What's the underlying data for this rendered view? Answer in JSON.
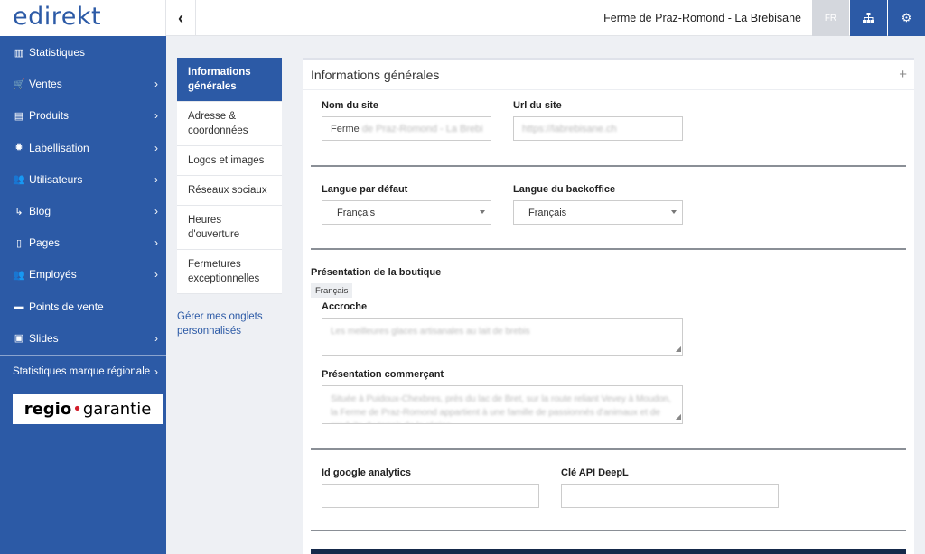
{
  "topbar": {
    "logo": "edirekt",
    "collapse_icon": "‹",
    "site_title": "Ferme de Praz-Romond - La Brebisane",
    "lang": "FR"
  },
  "sidebar": {
    "items": [
      {
        "icon": "chart-icon",
        "glyph": "▥",
        "label": "Statistiques",
        "chevron": false
      },
      {
        "icon": "cart-icon",
        "glyph": "🛒",
        "label": "Ventes",
        "chevron": true
      },
      {
        "icon": "box-icon",
        "glyph": "▤",
        "label": "Produits",
        "chevron": true
      },
      {
        "icon": "badge-icon",
        "glyph": "✹",
        "label": "Labellisation",
        "chevron": true
      },
      {
        "icon": "users-icon",
        "glyph": "👥",
        "label": "Utilisateurs",
        "chevron": true
      },
      {
        "icon": "rss-icon",
        "glyph": "↳",
        "label": "Blog",
        "chevron": true
      },
      {
        "icon": "page-icon",
        "glyph": "▯",
        "label": "Pages",
        "chevron": true
      },
      {
        "icon": "employees-icon",
        "glyph": "👥",
        "label": "Employés",
        "chevron": true
      },
      {
        "icon": "store-icon",
        "glyph": "▬",
        "label": "Points de vente",
        "chevron": false
      },
      {
        "icon": "slides-icon",
        "glyph": "▣",
        "label": "Slides",
        "chevron": true
      }
    ],
    "regional_label": "Statistiques marque régionale",
    "regio_logo": {
      "left": "regio",
      "dot": "•",
      "right": "garantie"
    }
  },
  "tabs": {
    "items": [
      {
        "label": "Informations générales",
        "active": true
      },
      {
        "label": "Adresse & coordonnées",
        "active": false
      },
      {
        "label": "Logos et images",
        "active": false
      },
      {
        "label": "Réseaux sociaux",
        "active": false
      },
      {
        "label": "Heures d'ouverture",
        "active": false
      },
      {
        "label": "Fermetures exceptionnelles",
        "active": false
      }
    ],
    "manage_link": "Gérer mes onglets personnalisés"
  },
  "panel": {
    "title": "Informations générales",
    "plus": "+",
    "site_name_label": "Nom du site",
    "site_name_value_visible": "Ferme",
    "site_name_value_blurred": "de Praz-Romond - La Brebi",
    "site_url_label": "Url du site",
    "site_url_value_blurred": "https://labrebisane.ch",
    "default_lang_label": "Langue par défaut",
    "default_lang_value": "Français",
    "backoffice_lang_label": "Langue du backoffice",
    "backoffice_lang_value": "Français",
    "shop_presentation_label": "Présentation de la boutique",
    "lang_badge": "Français",
    "tagline_label": "Accroche",
    "tagline_value": "Les meilleures glaces artisanales au lait de brebis",
    "merchant_label": "Présentation commerçant",
    "merchant_value": "Située à Puidoux-Chexbres, près du lac de Bret, sur la route reliant Vevey à Moudon, la Ferme de Praz-Romond appartient à une famille de passionnés d'animaux et de produits du terroir de la région.",
    "ga_label": "Id google analytics",
    "ga_value": "",
    "deepl_label": "Clé API DeepL",
    "deepl_value": ""
  }
}
